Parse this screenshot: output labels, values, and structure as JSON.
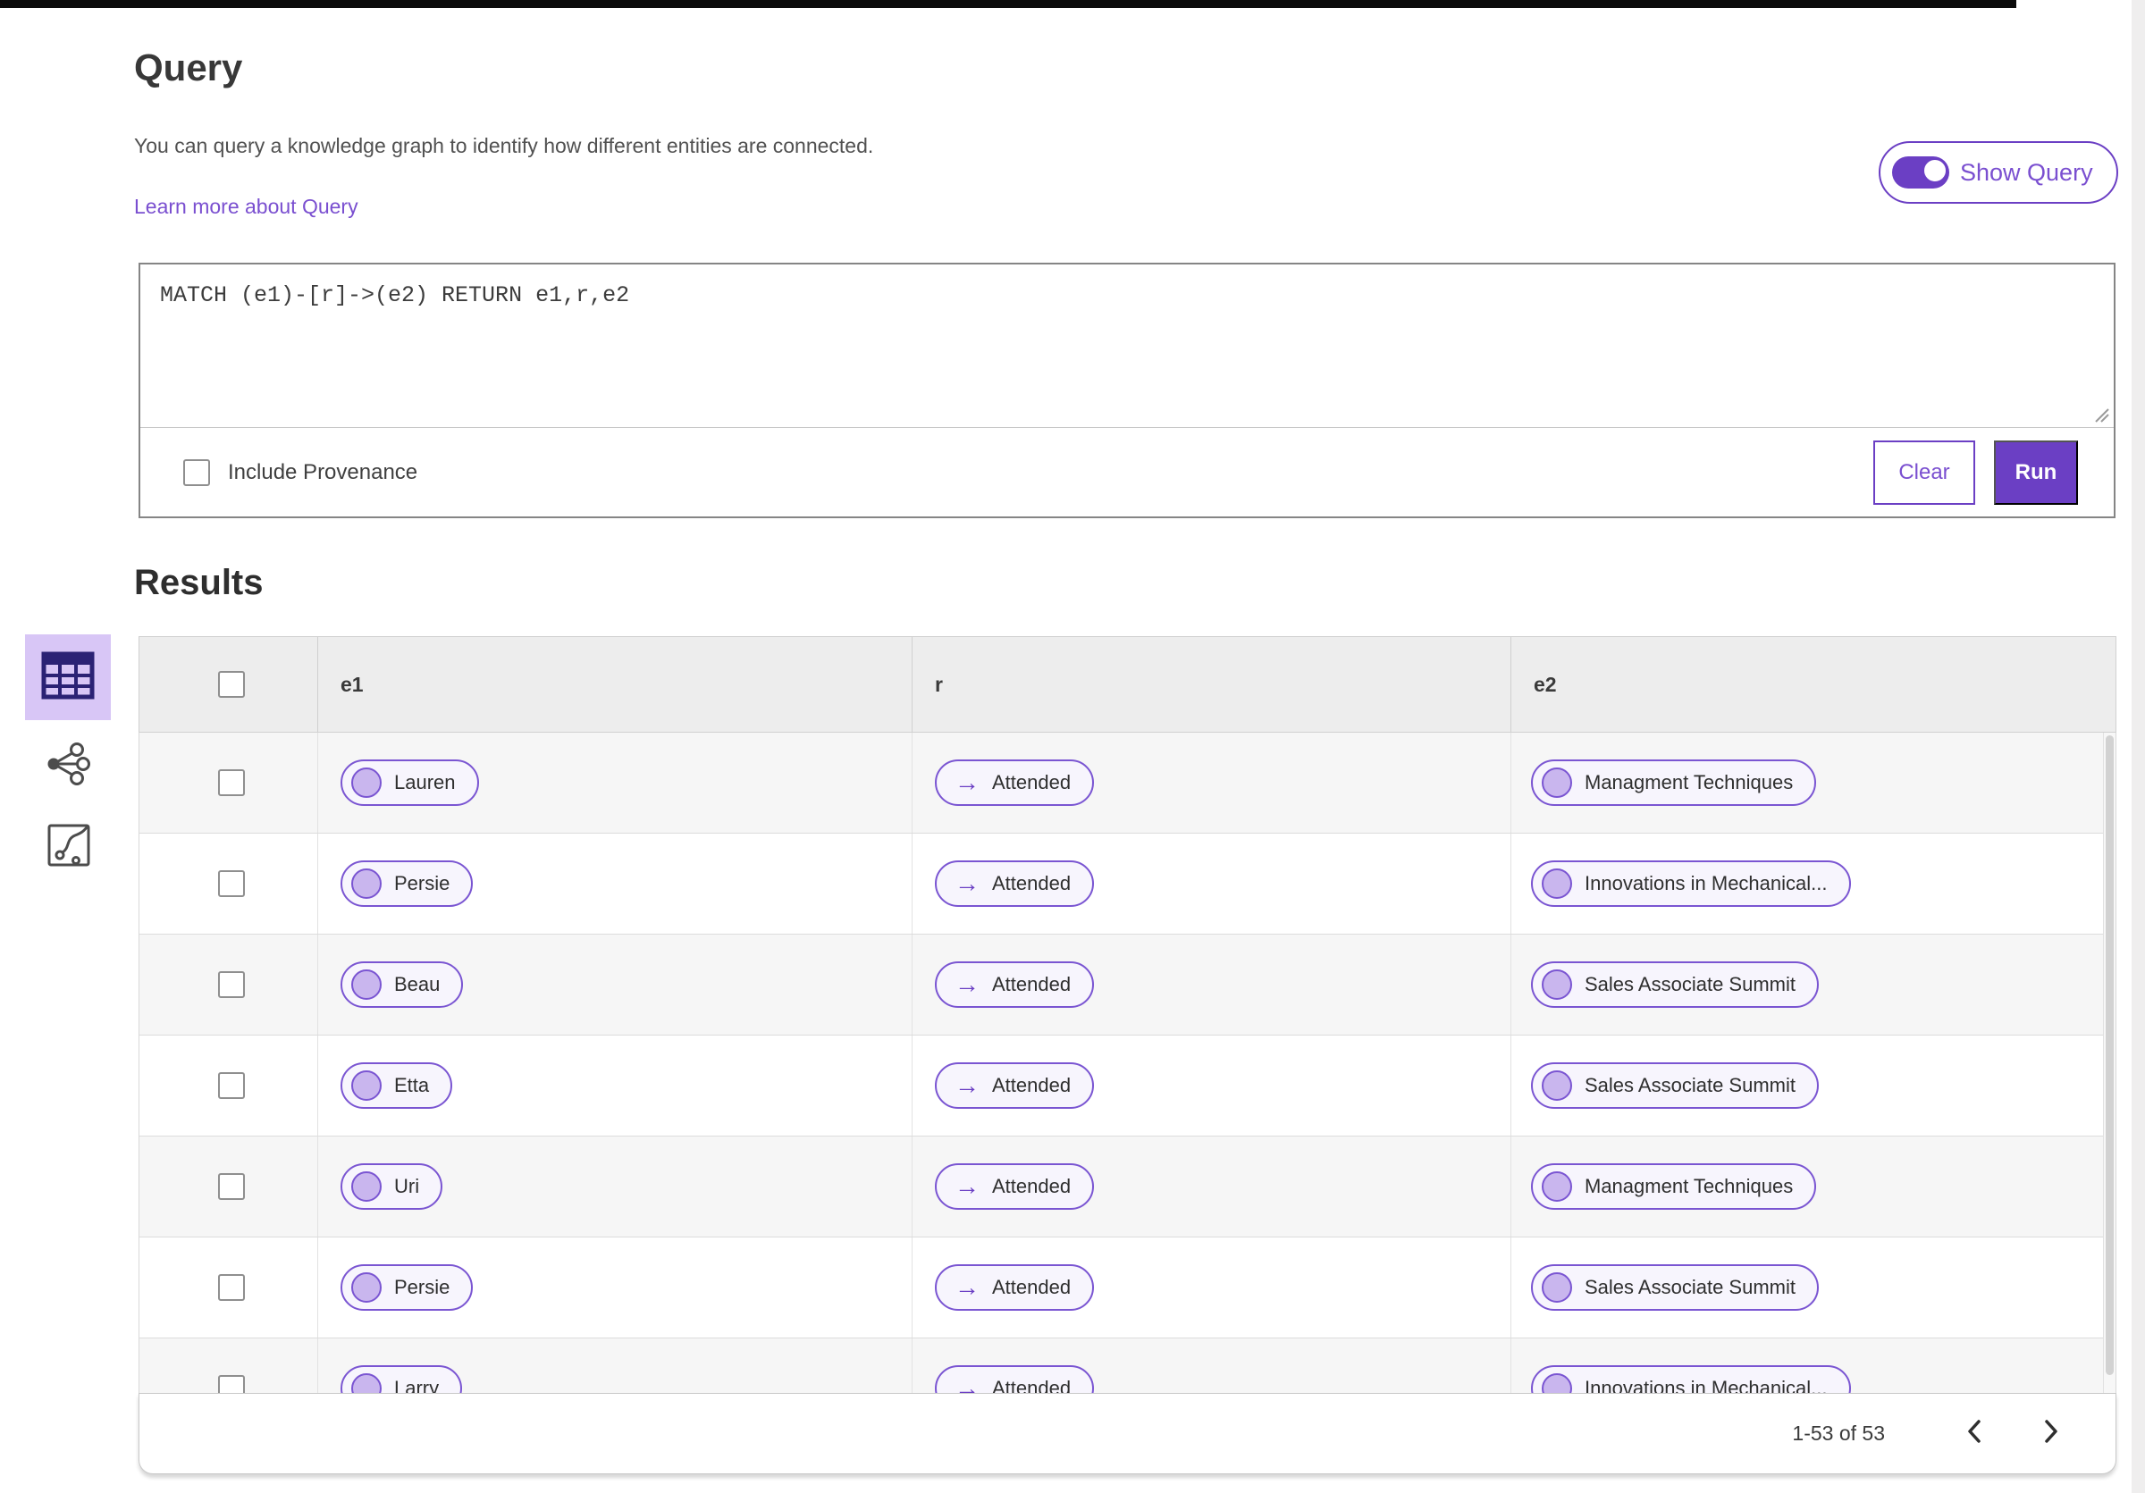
{
  "colors": {
    "accent": "#6b3fc4",
    "accent-border": "#7a55d2",
    "pill-bg": "#f7f5fd",
    "circle-fill": "#c9b6ee",
    "link": "#7a4fd0",
    "selected-tile": "#d8c6f6",
    "icon-dark": "#2b2274",
    "header-bg": "#ededed",
    "row-alt": "#f6f6f6",
    "text-dark": "#383838",
    "text-mid": "#515151"
  },
  "query_section": {
    "title": "Query",
    "description": "You can query a knowledge graph to identify how different entities are connected.",
    "learn_more_label": "Learn more about Query",
    "show_query_label": "Show Query",
    "show_query_on": true,
    "query_text": "MATCH (e1)-[r]->(e2) RETURN e1,r,e2",
    "include_provenance_label": "Include Provenance",
    "include_provenance_checked": false,
    "clear_label": "Clear",
    "run_label": "Run"
  },
  "results": {
    "title": "Results",
    "view_switcher": [
      {
        "name": "table-view-icon",
        "selected": true
      },
      {
        "name": "graph-view-icon",
        "selected": false
      },
      {
        "name": "path-view-icon",
        "selected": false
      }
    ],
    "columns": [
      "e1",
      "r",
      "e2"
    ],
    "relation_arrow": "→",
    "rows": [
      {
        "e1": "Lauren",
        "r": "Attended",
        "e2": "Managment Techniques"
      },
      {
        "e1": "Persie",
        "r": "Attended",
        "e2": "Innovations in Mechanical..."
      },
      {
        "e1": "Beau",
        "r": "Attended",
        "e2": "Sales Associate Summit"
      },
      {
        "e1": "Etta",
        "r": "Attended",
        "e2": "Sales Associate Summit"
      },
      {
        "e1": "Uri",
        "r": "Attended",
        "e2": "Managment Techniques"
      },
      {
        "e1": "Persie",
        "r": "Attended",
        "e2": "Sales Associate Summit"
      },
      {
        "e1": "Larry",
        "r": "Attended",
        "e2": "Innovations in Mechanical..."
      }
    ],
    "pagination": {
      "range_label": "1-53 of 53"
    }
  }
}
